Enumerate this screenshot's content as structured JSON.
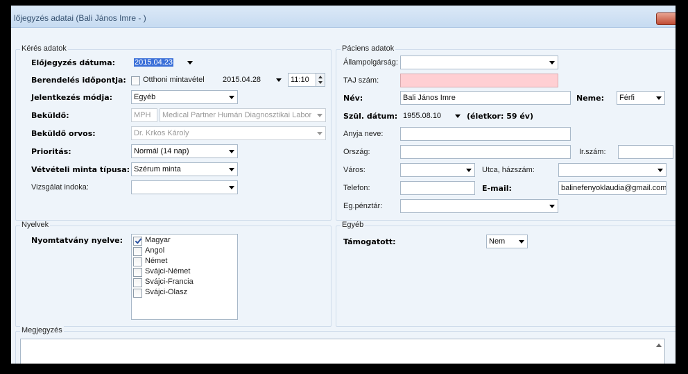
{
  "window": {
    "title": "lőjegyzés adatai (Bali János Imre - )"
  },
  "keres": {
    "legend": "Kérés adatok",
    "elojegyzes_label": "Előjegyzés dátuma:",
    "elojegyzes_value": "2015.04.23",
    "berendeles_label": "Berendelés időpontja:",
    "otthoni_label": "Otthoni mintavétel",
    "otthoni_checked": false,
    "berendeles_date": "2015.04.28",
    "berendeles_time": "11:10",
    "jelentkezes_label": "Jelentkezés módja:",
    "jelentkezes_value": "Egyéb",
    "bekuldo_label": "Beküldő:",
    "bekuldo_code": "MPH",
    "bekuldo_name": "Medical Partner Humán Diagnosztikai Labor",
    "bekuldo_orvos_label": "Beküldő orvos:",
    "bekuldo_orvos_value": "Dr. Krkos Károly",
    "prioritas_label": "Prioritás:",
    "prioritas_value": "Normál (14 nap)",
    "minta_label": "Vétvételi minta típusa:",
    "minta_value": "Szérum minta",
    "indok_label": "Vizsgálat indoka:",
    "indok_value": ""
  },
  "paciens": {
    "legend": "Páciens adatok",
    "allampolgarsag_label": "Állampolgárság:",
    "allampolgarsag_value": "",
    "taj_label": "TAJ szám:",
    "taj_value": "",
    "nev_label": "Név:",
    "nev_value": "Bali János Imre",
    "neme_label": "Neme:",
    "neme_value": "Férfi",
    "szul_label": "Szül. dátum:",
    "szul_value": "1955.08.10",
    "eletkor": "(életkor: 59 év)",
    "anyja_label": "Anyja neve:",
    "anyja_value": "",
    "orszag_label": "Ország:",
    "orszag_value": "",
    "irszam_label": "Ir.szám:",
    "irszam_value": "",
    "varos_label": "Város:",
    "varos_value": "",
    "utca_label": "Utca, házszám:",
    "utca_value": "",
    "telefon_label": "Telefon:",
    "telefon_value": "",
    "email_label": "E-mail:",
    "email_value": "balinefenyoklaudia@gmail.com",
    "penztar_label": "Eg.pénztár:",
    "penztar_value": ""
  },
  "nyelvek": {
    "legend": "Nyelvek",
    "label": "Nyomtatvány nyelve:",
    "options": [
      {
        "label": "Magyar",
        "checked": true
      },
      {
        "label": "Angol",
        "checked": false
      },
      {
        "label": "Német",
        "checked": false
      },
      {
        "label": "Svájci-Német",
        "checked": false
      },
      {
        "label": "Svájci-Francia",
        "checked": false
      },
      {
        "label": "Svájci-Olasz",
        "checked": false
      }
    ]
  },
  "egyeb": {
    "legend": "Egyéb",
    "tamogatott_label": "Támogatott:",
    "tamogatott_value": "Nem"
  },
  "megjegyzes": {
    "legend": "Megjegyzés",
    "value": ""
  }
}
